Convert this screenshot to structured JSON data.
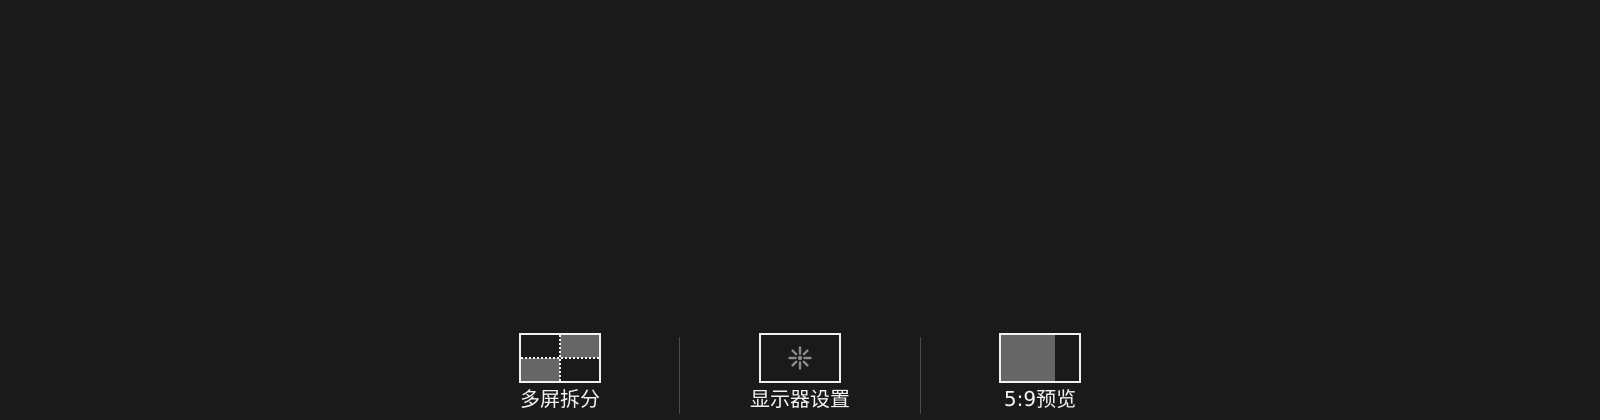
{
  "toolbar": {
    "items": [
      {
        "label": "多屏拆分",
        "icon": "multi-screen-split-icon"
      },
      {
        "label": "显示器设置",
        "icon": "display-settings-icon"
      },
      {
        "label": "5:9预览",
        "icon": "preview-ratio-icon",
        "fill_fraction": 0.69
      }
    ]
  },
  "colors": {
    "background": "#1a1a1a",
    "foreground": "#f2f2f2",
    "fill_gray": "#666666",
    "divider": "#4a4a4a",
    "icon_spinner": "#8a8a8a"
  }
}
